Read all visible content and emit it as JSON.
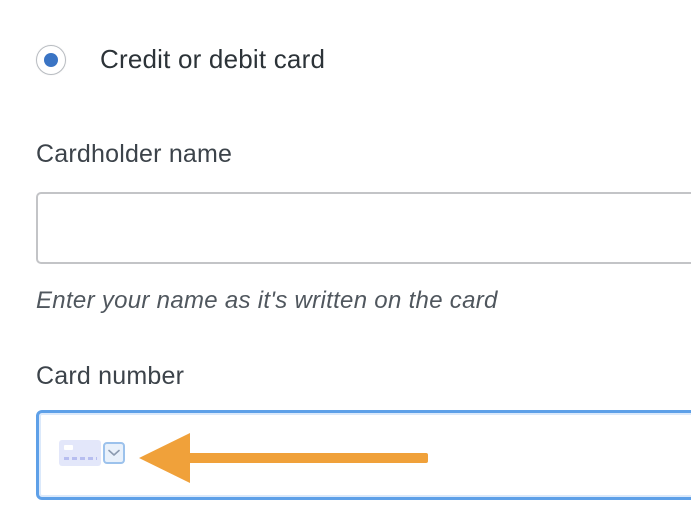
{
  "payment_method": {
    "option_label": "Credit or debit card",
    "selected": true
  },
  "cardholder": {
    "label": "Cardholder name",
    "value": "",
    "placeholder": "",
    "help": "Enter your name as it's written on the card"
  },
  "card_number": {
    "label": "Card number",
    "value": "",
    "brand_icon": "generic-card-icon",
    "dropdown_icon": "chevron-down-icon"
  },
  "annotation": {
    "icon": "arrow-left-icon",
    "color": "#f0a13a"
  },
  "colors": {
    "radio_selected": "#3a74c4",
    "focus_border": "#5ea0e8",
    "text": "#3c434a",
    "arrow": "#f0a13a"
  }
}
